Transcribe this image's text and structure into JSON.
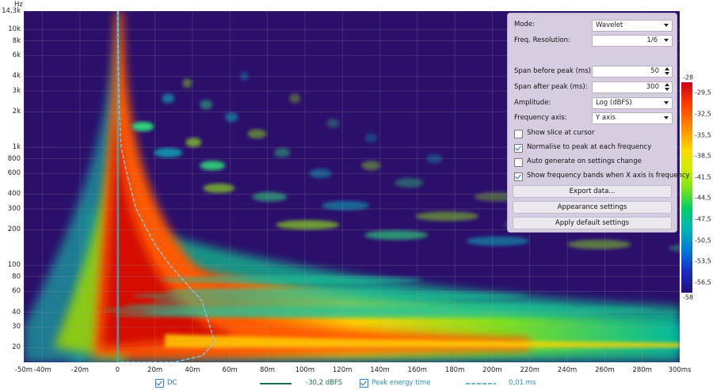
{
  "chart": {
    "y_unit": "Hz",
    "y_ticks": [
      "14,3k",
      "10k",
      "8k",
      "6k",
      "4k",
      "3k",
      "2k",
      "1k",
      "800",
      "600",
      "400",
      "300",
      "200",
      "100",
      "80",
      "60",
      "40",
      "30",
      "20"
    ],
    "x_ticks": [
      "-50m",
      "-40m",
      "-20m",
      "0",
      "20m",
      "40m",
      "60m",
      "80m",
      "100m",
      "120m",
      "140m",
      "160m",
      "180m",
      "200m",
      "220m",
      "240m",
      "260m",
      "280m",
      "300ms"
    ],
    "colorbar_ticks": [
      "-28",
      "-29,5",
      "-32,5",
      "-35,5",
      "-38,5",
      "-41,5",
      "-44,5",
      "-47,5",
      "-50,5",
      "-53,5",
      "-56,5",
      "-58"
    ]
  },
  "chart_data": {
    "type": "heatmap",
    "xlabel": "",
    "ylabel": "Hz",
    "xlim": [
      -50,
      300
    ],
    "ylim": [
      15,
      14300
    ],
    "y_scale": "log",
    "colorbar_range": [
      -58,
      -28
    ],
    "series": [
      {
        "name": "Peak energy time",
        "x": [
          0.2,
          0.5,
          1,
          2,
          5,
          10,
          20,
          28,
          45,
          52,
          45,
          30,
          15,
          5,
          2,
          1,
          0.5
        ],
        "y": [
          14300,
          5000,
          2000,
          1000,
          600,
          300,
          150,
          100,
          50,
          22,
          17,
          15,
          15,
          15,
          15,
          15,
          15
        ]
      }
    ]
  },
  "panel": {
    "mode_label": "Mode:",
    "mode_value": "Wavelet",
    "freq_res_label": "Freq. Resolution:",
    "freq_res_value": "1/6",
    "span_before_label": "Span before peak (ms):",
    "span_before_value": "50",
    "span_after_label": "Span after peak (ms):",
    "span_after_value": "300",
    "amplitude_label": "Amplitude:",
    "amplitude_value": "Log (dBFS)",
    "freq_axis_label": "Frequency axis:",
    "freq_axis_value": "Y axis",
    "cb_slice": "Show slice at cursor",
    "cb_normalise": "Normalise to peak at each frequency",
    "cb_autogen": "Auto generate on settings change",
    "cb_bands": "Show frequency bands when X axis is frequency",
    "btn_export": "Export data...",
    "btn_appearance": "Appearance settings",
    "btn_defaults": "Apply default settings"
  },
  "legend": {
    "dc_label": "DC",
    "dc_value": "-30,2 dBFS",
    "pet_label": "Peak energy time",
    "pet_value": "0,01 ms"
  },
  "colors": {
    "background": "#2b0f6b",
    "curve": "#7ec8e8",
    "dc_line": "#1d6b55"
  }
}
